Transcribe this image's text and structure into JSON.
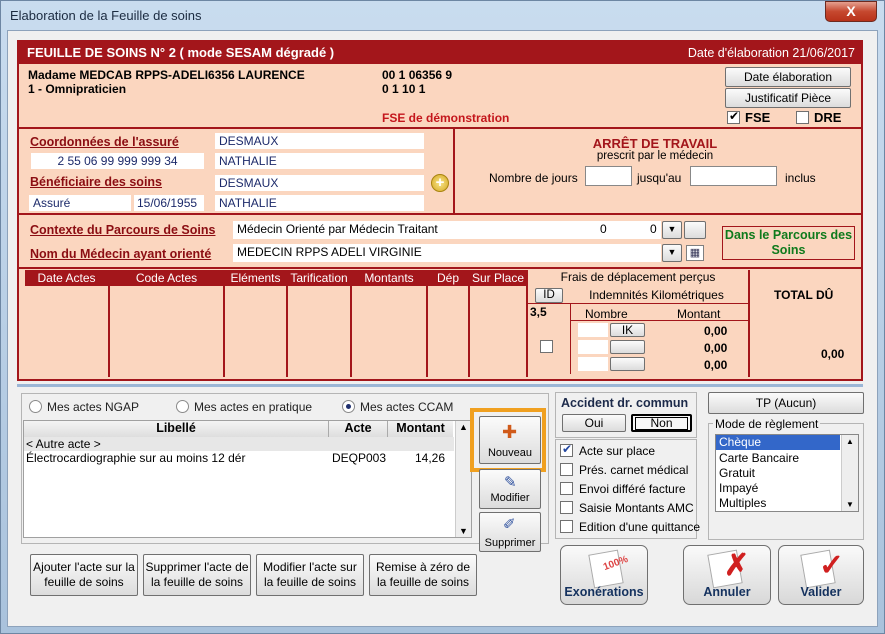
{
  "window": {
    "title": "Elaboration de la Feuille de soins",
    "close": "X"
  },
  "header": {
    "title": "FEUILLE DE SOINS  N° 2 ( mode SESAM dégradé )",
    "date": "Date d'élaboration 21/06/2017"
  },
  "doctor": {
    "name": "Madame MEDCAB RPPS-ADELI6356 LAURENCE",
    "specialty": "1 - Omnipraticien",
    "num1": "00 1 06356 9",
    "num2": "0 1 10 1",
    "fse_demo": "FSE de démonstration"
  },
  "buttons": {
    "date_elab": "Date élaboration",
    "justif": "Justificatif Pièce",
    "fse": "FSE",
    "dre": "DRE"
  },
  "assure": {
    "coord_label": "Coordonnées de l'assuré",
    "nir": "2 55 06 99 999 999 34",
    "nom": "DESMAUX",
    "prenom": "NATHALIE",
    "benef_label": "Bénéficiaire des soins",
    "benef_nom": "DESMAUX",
    "benef_prenom": "NATHALIE",
    "qualite": "Assuré",
    "date_naiss": "15/06/1955"
  },
  "arret": {
    "title": "ARRÊT DE TRAVAIL",
    "sub": "prescrit par le médecin",
    "nb_jours": "Nombre de jours",
    "jusquau": "jusqu'au",
    "inclus": "inclus"
  },
  "parcours": {
    "ctx_label": "Contexte du Parcours de Soins",
    "ctx_value": "Médecin Orienté par Médecin Traitant",
    "v1": "0",
    "v2": "0",
    "med_label": "Nom du Médecin ayant orienté",
    "med_value": "MEDECIN RPPS ADELI   VIRGINIE",
    "dans": "Dans le Parcours des Soins"
  },
  "actes_table": {
    "cols": [
      "Date Actes",
      "Code Actes",
      "Eléments",
      "Tarification",
      "Montants",
      "Dép",
      "Sur Place"
    ],
    "frais": "Frais de déplacement perçus",
    "id": "ID",
    "indem": "Indemnités Kilométriques",
    "val35": "3,5",
    "nombre": "Nombre",
    "montant": "Montant",
    "ik": "IK",
    "m1": "0,00",
    "m2": "0,00",
    "m3": "0,00",
    "total_label": "TOTAL DÛ",
    "total": "0,00"
  },
  "radios": {
    "ngap": "Mes actes NGAP",
    "pratique": "Mes actes en pratique",
    "ccam": "Mes actes CCAM"
  },
  "list": {
    "cols": [
      "Libellé",
      "Acte",
      "Montant"
    ],
    "rows": [
      {
        "lib": "< Autre acte >",
        "acte": "",
        "mont": ""
      },
      {
        "lib": "Électrocardiographie sur au moins 12 dér",
        "acte": "DEQP003",
        "mont": "14,26"
      }
    ]
  },
  "side_buttons": {
    "nouveau": "Nouveau",
    "modifier": "Modifier",
    "supprimer": "Supprimer"
  },
  "bottom_buttons": {
    "ajouter": "Ajouter l'acte sur la feuille de soins",
    "supprimer": "Supprimer l'acte de la feuille de soins",
    "modifier": "Modifier l'acte sur la feuille de soins",
    "remise": "Remise à zéro de la feuille de soins"
  },
  "accident": {
    "title": "Accident dr. commun",
    "oui": "Oui",
    "non": "Non"
  },
  "options": [
    "Acte sur place",
    "Prés. carnet médical",
    "Envoi différé facture",
    "Saisie Montants AMC",
    "Edition d'une quittance"
  ],
  "tp": "TP (Aucun)",
  "reglement": {
    "title": "Mode de règlement",
    "items": [
      "Chèque",
      "Carte Bancaire",
      "Gratuit",
      "Impayé",
      "Multiples"
    ]
  },
  "actions": {
    "exo": "Exonérations",
    "exo_badge": "100%",
    "annuler": "Annuler",
    "valider": "Valider"
  },
  "colors": {
    "accent_red": "#a3161b",
    "highlight_orange": "#f0a020"
  }
}
